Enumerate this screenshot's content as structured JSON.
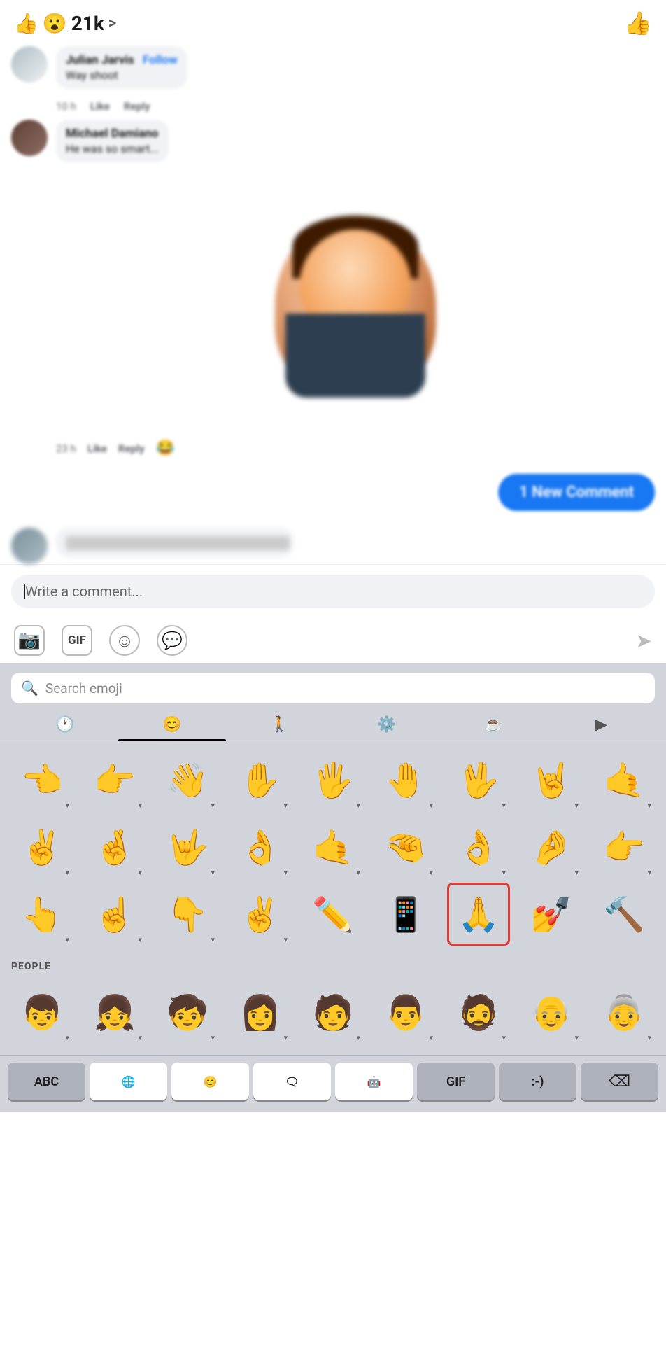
{
  "reaction_bar": {
    "like_emoji": "👍",
    "wow_emoji": "😮",
    "count": "21k",
    "chevron": ">",
    "thumbs_up": "👍"
  },
  "comments": [
    {
      "name": "Julian Jarvis",
      "follow_label": "Follow",
      "text": "Way shoot",
      "time": "10 h",
      "like": "Like",
      "reply": "Reply"
    },
    {
      "name": "Michael Damiano",
      "text": "He was so smart...",
      "time": "23 h",
      "like": "Like",
      "reply": "Reply"
    }
  ],
  "new_comment_badge": "1 New Comment",
  "write_comment": {
    "placeholder": "Write a comment..."
  },
  "toolbar": {
    "camera_label": "📷",
    "gif_label": "GIF",
    "emoji_label": "☺",
    "sticker_label": "💬",
    "send_label": "➤"
  },
  "emoji_keyboard": {
    "search_placeholder": "Search emoji",
    "categories": [
      {
        "icon": "🕐",
        "label": "recent"
      },
      {
        "icon": "😊",
        "label": "smileys",
        "active": true
      },
      {
        "icon": "🚶",
        "label": "people"
      },
      {
        "icon": "⚙️",
        "label": "activities"
      },
      {
        "icon": "☕",
        "label": "food"
      }
    ],
    "emoji_rows": [
      [
        "👈",
        "👉",
        "👋",
        "✋",
        "🖐",
        "🤚",
        "🖖",
        "🤘",
        "🤙"
      ],
      [
        "✌️",
        "🤞",
        "🤟",
        "👌",
        "🤙",
        "🤏",
        "👌",
        "🤌",
        "👉"
      ],
      [
        "👆",
        "☝️",
        "👇",
        "✌️",
        "✏️",
        "📱",
        "🙏",
        "💅",
        "🔨"
      ]
    ],
    "people_label": "PEOPLE",
    "people_row": [
      "👦",
      "👧",
      "🧒",
      "👩",
      "🧑",
      "👨",
      "🧔",
      "👴",
      "👵"
    ],
    "keyboard_bottom": {
      "abc": "ABC",
      "globe": "🌐",
      "emoji": "😊",
      "sticker": "🗨",
      "memoji": "🤖",
      "gif": "GIF",
      "emoticon": ":-)",
      "delete": "⌫"
    }
  }
}
